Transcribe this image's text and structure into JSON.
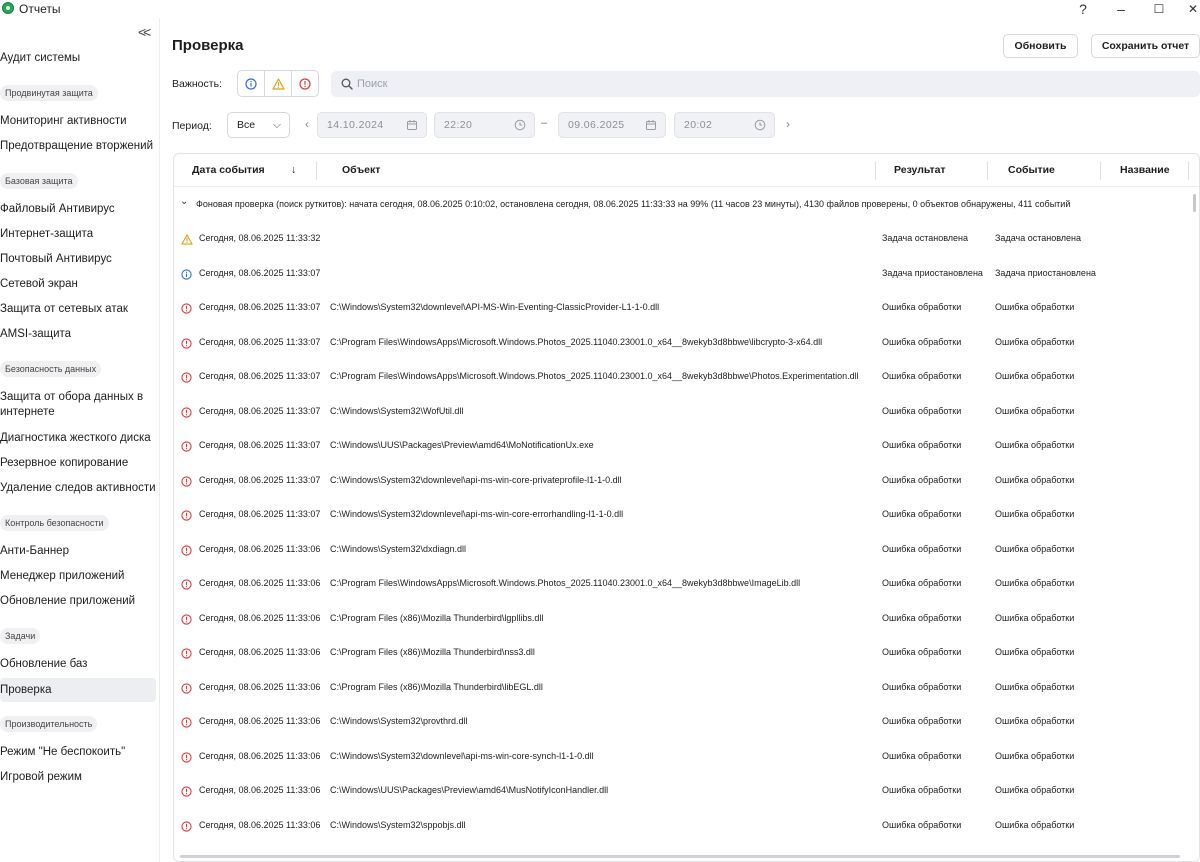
{
  "window": {
    "title": "Отчеты",
    "help": "?",
    "minimize": "–",
    "maximize": "☐",
    "close": "✕"
  },
  "sidebar": {
    "collapse": "<<",
    "entries": [
      {
        "kind": "item",
        "label": "Аудит системы"
      },
      {
        "kind": "group",
        "label": "Продвинутая защита"
      },
      {
        "kind": "item",
        "label": "Мониторинг активности"
      },
      {
        "kind": "item",
        "label": "Предотвращение вторжений"
      },
      {
        "kind": "group",
        "label": "Базовая защита"
      },
      {
        "kind": "item",
        "label": "Файловый Антивирус"
      },
      {
        "kind": "item",
        "label": "Интернет-защита"
      },
      {
        "kind": "item",
        "label": "Почтовый Антивирус"
      },
      {
        "kind": "item",
        "label": "Сетевой экран"
      },
      {
        "kind": "item",
        "label": "Защита от сетевых атак"
      },
      {
        "kind": "item",
        "label": "AMSI-защита"
      },
      {
        "kind": "group",
        "label": "Безопасность данных"
      },
      {
        "kind": "item",
        "label": "Защита от обора данных в интернете"
      },
      {
        "kind": "item",
        "label": "Диагностика жесткого диска"
      },
      {
        "kind": "item",
        "label": "Резервное копирование"
      },
      {
        "kind": "item",
        "label": "Удаление следов активности"
      },
      {
        "kind": "group",
        "label": "Контроль безопасности"
      },
      {
        "kind": "item",
        "label": "Анти-Баннер"
      },
      {
        "kind": "item",
        "label": "Менеджер приложений"
      },
      {
        "kind": "item",
        "label": "Обновление приложений"
      },
      {
        "kind": "group",
        "label": "Задачи"
      },
      {
        "kind": "item",
        "label": "Обновление баз"
      },
      {
        "kind": "item",
        "label": "Проверка",
        "active": true
      },
      {
        "kind": "group",
        "label": "Производительность"
      },
      {
        "kind": "item",
        "label": "Режим \"Не беспокоить\""
      },
      {
        "kind": "item",
        "label": "Игровой режим"
      }
    ]
  },
  "main": {
    "title": "Проверка",
    "refresh_button": "Обновить",
    "save_button": "Сохранить отчет",
    "severity_label": "Важность:",
    "search_placeholder": "Поиск",
    "period_label": "Период:",
    "period_value": "Все",
    "date_from": "14.10.2024",
    "time_from": "22:20",
    "date_to": "09.06.2025",
    "time_to": "20:02",
    "dash": "–",
    "prev": "‹",
    "next": "›"
  },
  "colors": {
    "info": "#2f6fd6",
    "warning": "#e0a018",
    "error": "#d93b3b"
  },
  "table": {
    "columns": {
      "date": "Дата события",
      "sort_arrow": "↓",
      "object": "Объект",
      "result": "Результат",
      "event": "Событие",
      "name": "Название"
    },
    "group_text": "Фоновая проверка (поиск руткитов): начата сегодня, 08.06.2025 0:10:02, остановлена сегодня, 08.06.2025 11:33:33 на 99% (11 часов 23 минуты), 4130 файлов проверены, 0 объектов обнаружены, 411 событий",
    "rows": [
      {
        "icon": "warning",
        "date": "Сегодня, 08.06.2025 11:33:32",
        "object": "",
        "result": "Задача остановлена",
        "event": "Задача остановлена"
      },
      {
        "icon": "info",
        "date": "Сегодня, 08.06.2025 11:33:07",
        "object": "",
        "result": "Задача приостановлена",
        "event": "Задача приостановлена"
      },
      {
        "icon": "error",
        "date": "Сегодня, 08.06.2025 11:33:07",
        "object": "C:\\Windows\\System32\\downlevel\\API-MS-Win-Eventing-ClassicProvider-L1-1-0.dll",
        "result": "Ошибка обработки",
        "event": "Ошибка обработки"
      },
      {
        "icon": "error",
        "date": "Сегодня, 08.06.2025 11:33:07",
        "object": "C:\\Program Files\\WindowsApps\\Microsoft.Windows.Photos_2025.11040.23001.0_x64__8wekyb3d8bbwe\\libcrypto-3-x64.dll",
        "result": "Ошибка обработки",
        "event": "Ошибка обработки"
      },
      {
        "icon": "error",
        "date": "Сегодня, 08.06.2025 11:33:07",
        "object": "C:\\Program Files\\WindowsApps\\Microsoft.Windows.Photos_2025.11040.23001.0_x64__8wekyb3d8bbwe\\Photos.Experimentation.dll",
        "result": "Ошибка обработки",
        "event": "Ошибка обработки"
      },
      {
        "icon": "error",
        "date": "Сегодня, 08.06.2025 11:33:07",
        "object": "C:\\Windows\\System32\\WofUtil.dll",
        "result": "Ошибка обработки",
        "event": "Ошибка обработки"
      },
      {
        "icon": "error",
        "date": "Сегодня, 08.06.2025 11:33:07",
        "object": "C:\\Windows\\UUS\\Packages\\Preview\\amd64\\MoNotificationUx.exe",
        "result": "Ошибка обработки",
        "event": "Ошибка обработки"
      },
      {
        "icon": "error",
        "date": "Сегодня, 08.06.2025 11:33:07",
        "object": "C:\\Windows\\System32\\downlevel\\api-ms-win-core-privateprofile-l1-1-0.dll",
        "result": "Ошибка обработки",
        "event": "Ошибка обработки"
      },
      {
        "icon": "error",
        "date": "Сегодня, 08.06.2025 11:33:07",
        "object": "C:\\Windows\\System32\\downlevel\\api-ms-win-core-errorhandling-l1-1-0.dll",
        "result": "Ошибка обработки",
        "event": "Ошибка обработки"
      },
      {
        "icon": "error",
        "date": "Сегодня, 08.06.2025 11:33:06",
        "object": "C:\\Windows\\System32\\dxdiagn.dll",
        "result": "Ошибка обработки",
        "event": "Ошибка обработки"
      },
      {
        "icon": "error",
        "date": "Сегодня, 08.06.2025 11:33:06",
        "object": "C:\\Program Files\\WindowsApps\\Microsoft.Windows.Photos_2025.11040.23001.0_x64__8wekyb3d8bbwe\\ImageLib.dll",
        "result": "Ошибка обработки",
        "event": "Ошибка обработки"
      },
      {
        "icon": "error",
        "date": "Сегодня, 08.06.2025 11:33:06",
        "object": "C:\\Program Files (x86)\\Mozilla Thunderbird\\lgpllibs.dll",
        "result": "Ошибка обработки",
        "event": "Ошибка обработки"
      },
      {
        "icon": "error",
        "date": "Сегодня, 08.06.2025 11:33:06",
        "object": "C:\\Program Files (x86)\\Mozilla Thunderbird\\nss3.dll",
        "result": "Ошибка обработки",
        "event": "Ошибка обработки"
      },
      {
        "icon": "error",
        "date": "Сегодня, 08.06.2025 11:33:06",
        "object": "C:\\Program Files (x86)\\Mozilla Thunderbird\\libEGL.dll",
        "result": "Ошибка обработки",
        "event": "Ошибка обработки"
      },
      {
        "icon": "error",
        "date": "Сегодня, 08.06.2025 11:33:06",
        "object": "C:\\Windows\\System32\\provthrd.dll",
        "result": "Ошибка обработки",
        "event": "Ошибка обработки"
      },
      {
        "icon": "error",
        "date": "Сегодня, 08.06.2025 11:33:06",
        "object": "C:\\Windows\\System32\\downlevel\\api-ms-win-core-synch-l1-1-0.dll",
        "result": "Ошибка обработки",
        "event": "Ошибка обработки"
      },
      {
        "icon": "error",
        "date": "Сегодня, 08.06.2025 11:33:06",
        "object": "C:\\Windows\\UUS\\Packages\\Preview\\amd64\\MusNotifyIconHandler.dll",
        "result": "Ошибка обработки",
        "event": "Ошибка обработки"
      },
      {
        "icon": "error",
        "date": "Сегодня, 08.06.2025 11:33:06",
        "object": "C:\\Windows\\System32\\sppobjs.dll",
        "result": "Ошибка обработки",
        "event": "Ошибка обработки"
      }
    ]
  }
}
